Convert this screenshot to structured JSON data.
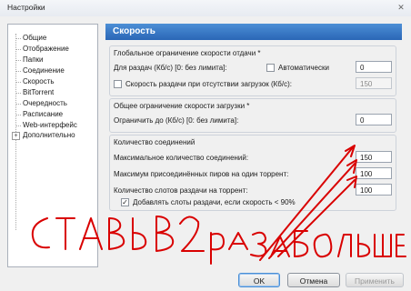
{
  "window": {
    "title": "Настройки"
  },
  "sidebar": {
    "items": [
      {
        "label": "Общие"
      },
      {
        "label": "Отображение"
      },
      {
        "label": "Папки"
      },
      {
        "label": "Соединение"
      },
      {
        "label": "Скорость"
      },
      {
        "label": "BitTorrent"
      },
      {
        "label": "Очередность"
      },
      {
        "label": "Расписание"
      },
      {
        "label": "Web-интерфейс"
      },
      {
        "label": "Дополнительно"
      }
    ]
  },
  "panel": {
    "title": "Скорость",
    "global_limit": {
      "title": "Глобальное ограничение скорости отдачи *",
      "upload_label": "Для раздач (Кб/с) [0: без лимита]:",
      "auto_label": "Автоматически",
      "upload_value": "0",
      "no_download_label": "Скорость раздачи при отсутствии загрузок (Кб/с):",
      "no_download_value": "150"
    },
    "download_limit": {
      "title": "Общее ограничение скорости загрузки *",
      "limit_label": "Ограничить до (Кб/с) [0: без лимита]:",
      "limit_value": "0"
    },
    "connections": {
      "title": "Количество соединений",
      "max_label": "Максимальное количество соединений:",
      "max_value": "150",
      "peers_label": "Максимум присоединённых пиров на один торрент:",
      "peers_value": "100",
      "slots_label": "Количество слотов раздачи на торрент:",
      "slots_value": "100",
      "add_slots_label": "Добавлять слоты раздачи, если скорость < 90%"
    }
  },
  "buttons": {
    "ok": "OK",
    "cancel": "Отмена",
    "apply": "Применить"
  },
  "colors": {
    "header": "#2a66b6",
    "annotation": "#d90000"
  },
  "annotation": {
    "text": "СТАВЬ В 2 РАЗА БОЛЬШЕ"
  }
}
